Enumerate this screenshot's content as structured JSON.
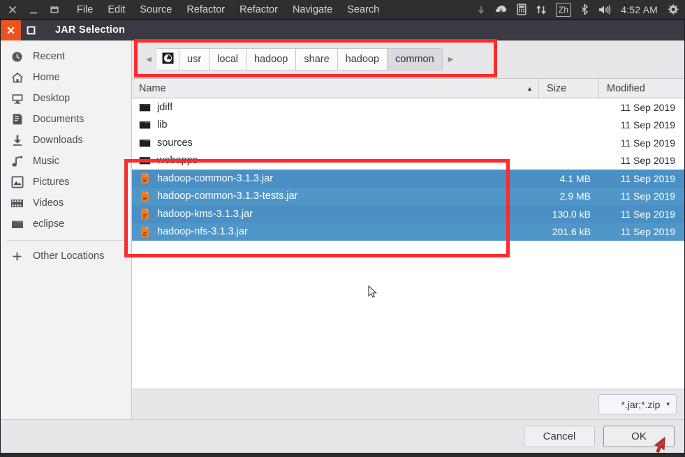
{
  "desktop_panel": {
    "window_buttons": [
      {
        "name": "close",
        "icon": "close-icon"
      },
      {
        "name": "minimize",
        "icon": "minimize-icon"
      },
      {
        "name": "restore",
        "icon": "restore-icon"
      }
    ],
    "menus": [
      "File",
      "Edit",
      "Source",
      "Refactor",
      "Refactor",
      "Navigate",
      "Search"
    ],
    "indicators": {
      "overflow_icon": "chevron-down-icon",
      "update_icon": "software-update-icon",
      "calculator_icon": "calculator-icon",
      "network_icon": "network-transfer-icon",
      "input_method": "Zh",
      "bluetooth_icon": "bluetooth-icon",
      "volume_icon": "volume-icon",
      "clock": "4:52 AM",
      "settings_icon": "gear-icon"
    }
  },
  "dialog": {
    "title": "JAR Selection",
    "close_label": "✕",
    "maximize_label": "□"
  },
  "sidebar": {
    "items": [
      {
        "label": "Recent",
        "icon": "clock-icon"
      },
      {
        "label": "Home",
        "icon": "home-icon"
      },
      {
        "label": "Desktop",
        "icon": "monitor-icon"
      },
      {
        "label": "Documents",
        "icon": "document-icon"
      },
      {
        "label": "Downloads",
        "icon": "download-arrow-icon"
      },
      {
        "label": "Music",
        "icon": "music-note-icon"
      },
      {
        "label": "Pictures",
        "icon": "picture-icon"
      },
      {
        "label": "Videos",
        "icon": "film-strip-icon"
      },
      {
        "label": "eclipse",
        "icon": "folder-icon"
      }
    ],
    "other_locations": {
      "label": "Other Locations",
      "icon": "plus-icon"
    }
  },
  "pathbar": {
    "prev_label": "◀",
    "next_label": "▶",
    "root_icon": "disk-icon",
    "crumbs": [
      {
        "label": "usr",
        "active": false
      },
      {
        "label": "local",
        "active": false
      },
      {
        "label": "hadoop",
        "active": false
      },
      {
        "label": "share",
        "active": false
      },
      {
        "label": "hadoop",
        "active": false
      },
      {
        "label": "common",
        "active": true
      }
    ]
  },
  "filelist": {
    "columns": {
      "name": "Name",
      "size": "Size",
      "modified": "Modified"
    },
    "sort_arrow": "▲",
    "rows": [
      {
        "name": "jdiff",
        "size": "",
        "modified": "11 Sep 2019",
        "icon": "folder-icon",
        "selected": false
      },
      {
        "name": "lib",
        "size": "",
        "modified": "11 Sep 2019",
        "icon": "folder-icon",
        "selected": false
      },
      {
        "name": "sources",
        "size": "",
        "modified": "11 Sep 2019",
        "icon": "folder-icon",
        "selected": false
      },
      {
        "name": "webapps",
        "size": "",
        "modified": "11 Sep 2019",
        "icon": "folder-icon",
        "selected": false
      },
      {
        "name": "hadoop-common-3.1.3.jar",
        "size": "4.1 MB",
        "modified": "11 Sep 2019",
        "icon": "jar-file-icon",
        "selected": true
      },
      {
        "name": "hadoop-common-3.1.3-tests.jar",
        "size": "2.9 MB",
        "modified": "11 Sep 2019",
        "icon": "jar-file-icon",
        "selected": true
      },
      {
        "name": "hadoop-kms-3.1.3.jar",
        "size": "130.0 kB",
        "modified": "11 Sep 2019",
        "icon": "jar-file-icon",
        "selected": true
      },
      {
        "name": "hadoop-nfs-3.1.3.jar",
        "size": "201.6 kB",
        "modified": "11 Sep 2019",
        "icon": "jar-file-icon",
        "selected": true
      }
    ]
  },
  "filter": {
    "value": "*.jar;*.zip",
    "caret": "▾"
  },
  "actions": {
    "cancel_label": "Cancel",
    "ok_label": "OK"
  },
  "annotations": {
    "accent_color": "#fb2c2c",
    "boxes": [
      "path-bar-highlight",
      "selected-jars-highlight"
    ],
    "pointer": "red-arrow-cursor"
  },
  "colors": {
    "selection_blue": "#4a90c4",
    "titlebar": "#3a3a42",
    "close_button_orange": "#e9541f",
    "panel_dark": "#2f2f2f",
    "dialog_chrome": "#e7e7ea"
  }
}
